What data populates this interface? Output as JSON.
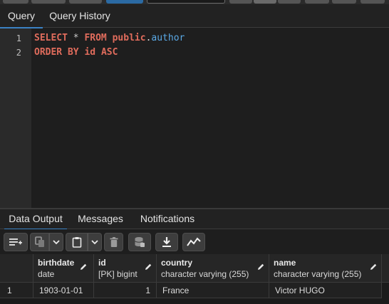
{
  "query_tabs": [
    {
      "label": "Query",
      "active": true
    },
    {
      "label": "Query History",
      "active": false
    }
  ],
  "editor": {
    "lines": [
      {
        "number": "1",
        "keyword": "SELECT",
        "operator": "*",
        "from": "FROM",
        "schema": "public",
        "dot": ".",
        "table": "author"
      },
      {
        "number": "2",
        "order": "ORDER BY",
        "column": "id",
        "direction": "ASC"
      }
    ]
  },
  "result_tabs": [
    {
      "label": "Data Output",
      "active": true
    },
    {
      "label": "Messages",
      "active": false
    },
    {
      "label": "Notifications",
      "active": false
    }
  ],
  "toolbar": {
    "icons": [
      "add-row-icon",
      "copy-icon",
      "chevron-down-icon",
      "paste-icon",
      "chevron-down-icon",
      "delete-icon",
      "save-data-icon",
      "download-icon",
      "graph-icon"
    ]
  },
  "grid": {
    "columns": [
      {
        "name": "birthdate",
        "type": "date"
      },
      {
        "name": "id",
        "type": "[PK] bigint"
      },
      {
        "name": "country",
        "type": "character varying (255)"
      },
      {
        "name": "name",
        "type": "character varying (255)"
      }
    ],
    "rows": [
      {
        "row_number": "1",
        "cells": [
          "1903-01-01",
          "1",
          "France",
          "Victor HUGO"
        ]
      }
    ]
  },
  "colors": {
    "accent": "#3b82c4",
    "keyword": "#e06c5c",
    "table_name": "#5aa9e6"
  }
}
